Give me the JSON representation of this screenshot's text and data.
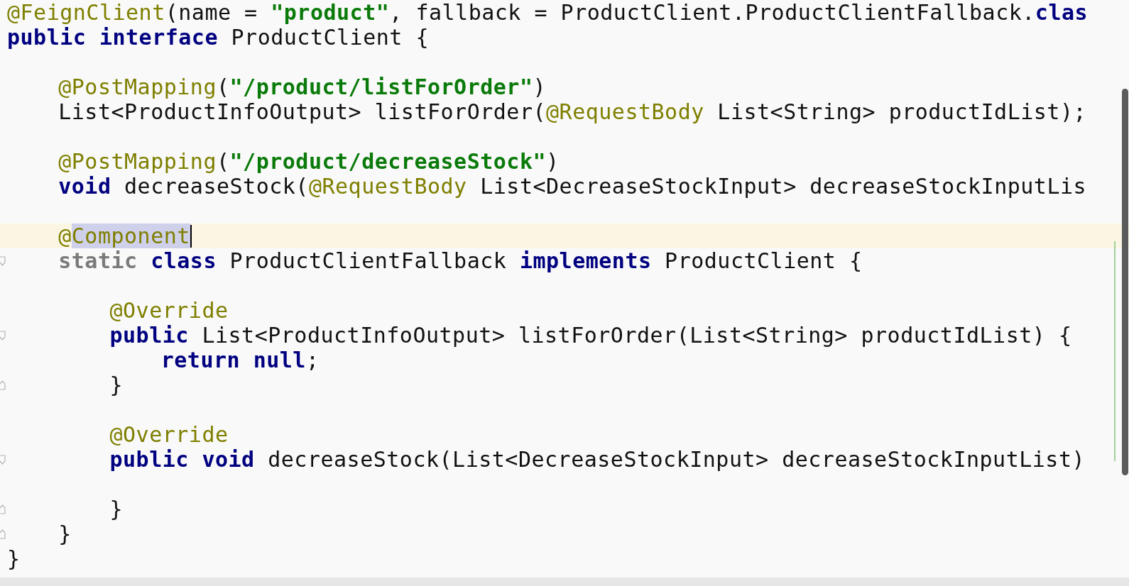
{
  "editor": {
    "lines": [
      {
        "kind": "code",
        "tokens": [
          {
            "kind": "annotation",
            "text": "@FeignClient"
          },
          {
            "kind": "plain",
            "text": "(name = "
          },
          {
            "kind": "string",
            "text": "\"product\""
          },
          {
            "kind": "plain",
            "text": ", fallback = ProductClient.ProductClientFallback."
          },
          {
            "kind": "keyword",
            "text": "clas"
          }
        ]
      },
      {
        "kind": "code",
        "tokens": [
          {
            "kind": "keyword",
            "text": "public interface"
          },
          {
            "kind": "plain",
            "text": " ProductClient {"
          }
        ],
        "children": [
          {
            "kind": "blank"
          },
          {
            "kind": "code",
            "tokens": [
              {
                "kind": "annotation",
                "text": "@PostMapping"
              },
              {
                "kind": "plain",
                "text": "("
              },
              {
                "kind": "string",
                "text": "\"/product/listForOrder\""
              },
              {
                "kind": "plain",
                "text": ")"
              }
            ]
          },
          {
            "kind": "code",
            "tokens": [
              {
                "kind": "plain",
                "text": "List<ProductInfoOutput> listForOrder("
              },
              {
                "kind": "annotation",
                "text": "@RequestBody"
              },
              {
                "kind": "plain",
                "text": " List<String> productIdList);"
              }
            ]
          },
          {
            "kind": "blank"
          },
          {
            "kind": "code",
            "tokens": [
              {
                "kind": "annotation",
                "text": "@PostMapping"
              },
              {
                "kind": "plain",
                "text": "("
              },
              {
                "kind": "string",
                "text": "\"/product/decreaseStock\""
              },
              {
                "kind": "plain",
                "text": ")"
              }
            ]
          },
          {
            "kind": "code",
            "tokens": [
              {
                "kind": "keyword",
                "text": "void"
              },
              {
                "kind": "plain",
                "text": " decreaseStock("
              },
              {
                "kind": "annotation",
                "text": "@RequestBody"
              },
              {
                "kind": "plain",
                "text": " List<DecreaseStockInput> decreaseStockInputLis"
              }
            ]
          },
          {
            "kind": "blank"
          },
          {
            "kind": "code",
            "current": true,
            "caret": true,
            "tokens": [
              {
                "kind": "annotation",
                "text": "@"
              },
              {
                "kind": "annotation",
                "text": "Component",
                "selected": true
              }
            ]
          },
          {
            "kind": "code",
            "fold_start": true,
            "tokens": [
              {
                "kind": "redundant",
                "text": "static"
              },
              {
                "kind": "keyword",
                "text": " class"
              },
              {
                "kind": "plain",
                "text": " ProductClientFallback "
              },
              {
                "kind": "keyword",
                "text": "implements"
              },
              {
                "kind": "plain",
                "text": " ProductClient {"
              }
            ],
            "children": [
              {
                "kind": "blank"
              },
              {
                "kind": "code",
                "tokens": [
                  {
                    "kind": "annotation",
                    "text": "@Override"
                  }
                ]
              },
              {
                "kind": "code",
                "fold_start": true,
                "tokens": [
                  {
                    "kind": "keyword",
                    "text": "public"
                  },
                  {
                    "kind": "plain",
                    "text": " List<ProductInfoOutput> listForOrder(List<String> productIdList) {"
                  }
                ],
                "children": [
                  {
                    "kind": "code",
                    "tokens": [
                      {
                        "kind": "keyword",
                        "text": "return null"
                      },
                      {
                        "kind": "plain",
                        "text": ";"
                      }
                    ]
                  }
                ]
              },
              {
                "kind": "code",
                "fold_end": true,
                "tokens": [
                  {
                    "kind": "plain",
                    "text": "}"
                  }
                ]
              },
              {
                "kind": "blank"
              },
              {
                "kind": "code",
                "tokens": [
                  {
                    "kind": "annotation",
                    "text": "@Override"
                  }
                ]
              },
              {
                "kind": "code",
                "fold_start": true,
                "tokens": [
                  {
                    "kind": "keyword",
                    "text": "public void"
                  },
                  {
                    "kind": "plain",
                    "text": " decreaseStock(List<DecreaseStockInput> decreaseStockInputList)"
                  }
                ]
              },
              {
                "kind": "blank"
              },
              {
                "kind": "code",
                "fold_end": true,
                "tokens": [
                  {
                    "kind": "plain",
                    "text": "}"
                  }
                ]
              }
            ]
          },
          {
            "kind": "code",
            "fold_end": true,
            "tokens": [
              {
                "kind": "plain",
                "text": "}"
              }
            ]
          }
        ]
      },
      {
        "kind": "code",
        "tokens": [
          {
            "kind": "plain",
            "text": "}"
          }
        ]
      }
    ]
  }
}
